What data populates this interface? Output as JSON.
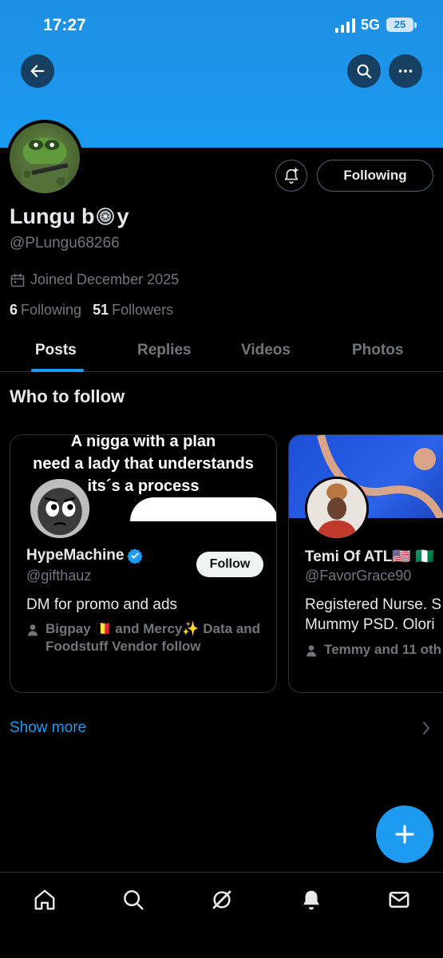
{
  "status_bar": {
    "time": "17:27",
    "network": "5G",
    "battery": "25"
  },
  "profile": {
    "display_name": "Lungu b",
    "display_name_suffix": "y",
    "handle": "@PLungu68266",
    "joined": "Joined December 2025",
    "following_count": "6",
    "following_label": "Following",
    "followers_count": "51",
    "followers_label": "Followers",
    "follow_state_button": "Following"
  },
  "tabs": [
    {
      "label": "Posts",
      "active": true
    },
    {
      "label": "Replies",
      "active": false
    },
    {
      "label": "Videos",
      "active": false
    },
    {
      "label": "Photos",
      "active": false
    }
  ],
  "who_to_follow": {
    "title": "Who to follow",
    "cards": [
      {
        "banner_lines": [
          "A nigga with a plan",
          "need a lady that understands",
          "its´s a process"
        ],
        "name": "HypeMachine",
        "verified": true,
        "handle": "@gifthauz",
        "bio": "DM for promo and ads",
        "mutual": "Bigpay 🇧🇪 and Mercy✨ Data and Foodstuff Vendor follow",
        "follow_label": "Follow"
      },
      {
        "name": "Temi Of ATL🇺🇸 🇳🇬",
        "handle": "@FavorGrace90",
        "bio_line1": "Registered Nurse. S",
        "bio_line2": "Mummy PSD. Olori",
        "mutual": "Temmy and 11 oth"
      }
    ],
    "show_more": "Show more"
  },
  "colors": {
    "accent": "#1d9bf0",
    "banner": "#1a9bf0",
    "muted": "#71767b"
  },
  "icons": {
    "back": "arrow-left-icon",
    "search": "search-icon",
    "more": "more-horizontal-icon",
    "notify": "bell-plus-icon",
    "calendar": "calendar-icon",
    "verified": "verified-badge-icon",
    "compose": "plus-icon",
    "nav": [
      "home-icon",
      "search-icon",
      "grok-icon",
      "bell-icon",
      "mail-icon"
    ]
  }
}
